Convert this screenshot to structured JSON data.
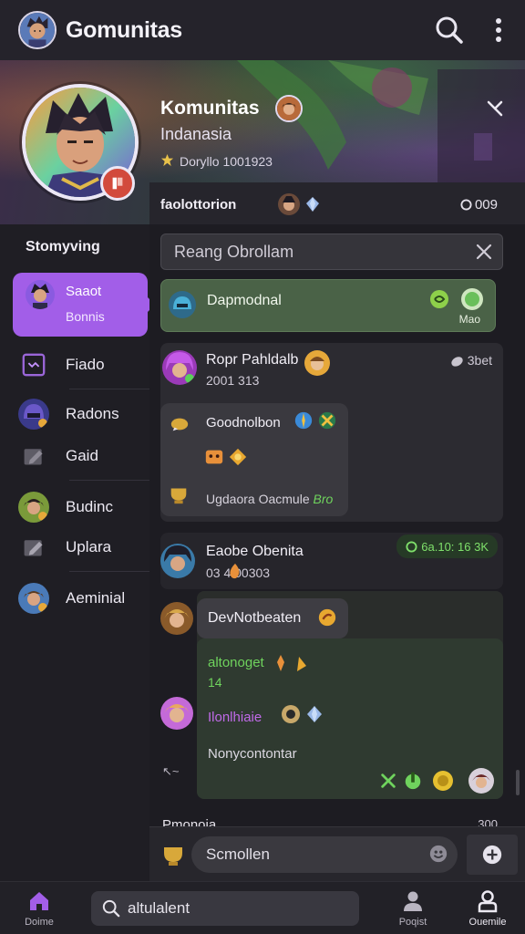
{
  "colors": {
    "accent": "#a25ee8",
    "green": "#6fd35d",
    "pinned_bg": "#4a6247",
    "background": "#1f1e25"
  },
  "header": {
    "app_title": "Gomunitas",
    "icons": [
      "search-icon",
      "more-vertical-icon"
    ]
  },
  "profile": {
    "name": "Komunitas",
    "region": "Indanasia",
    "meta": "Doryllo 1001923",
    "close_icon": "close-icon"
  },
  "subheader": {
    "title": "faolottorion",
    "count": "009"
  },
  "sidebar": {
    "heading": "Stomyving",
    "active_item": {
      "line1": "Saaot",
      "line2": "Bonnis"
    },
    "items": [
      {
        "label": "Fiado",
        "icon": "chat-square-icon"
      },
      {
        "label": "Radons",
        "icon": "helmet-avatar-icon"
      },
      {
        "label": "Gaid",
        "icon": "edit-folder-icon"
      },
      {
        "label": "Budinc",
        "icon": "user-avatar-icon"
      },
      {
        "label": "Uplara",
        "icon": "edit-icon"
      },
      {
        "label": "Aeminial",
        "icon": "user-avatar-icon"
      }
    ]
  },
  "search": {
    "placeholder": "Reang Obrollam"
  },
  "pinned": {
    "title": "Dapmodnal",
    "note": "Mao"
  },
  "post1": {
    "author": "Ropr Pahldalb",
    "time": "2001 313",
    "stat": "3bet",
    "bubble_title": "Goodnolbon",
    "footer": "Ugdaora Oacmule",
    "footer_tag": "Bro"
  },
  "post2": {
    "author": "Eaobe Obenita",
    "time": "03 4.00303",
    "badge": "6a.10: 16 3K"
  },
  "post3": {
    "bubble": "DevNotbeaten",
    "line1": "altonoget",
    "line2": "14",
    "line3": "Ilonlhiaie",
    "line4": "Nonycontontar",
    "side_glyph": "↖~"
  },
  "peek": {
    "label": "Pmonoia",
    "stat": "300"
  },
  "composer": {
    "placeholder": "Scmollen"
  },
  "bottom_nav": {
    "home_label": "Doime",
    "search_placeholder": "altulalent",
    "profile_label": "Poqist",
    "account_label": "Ouemile"
  }
}
